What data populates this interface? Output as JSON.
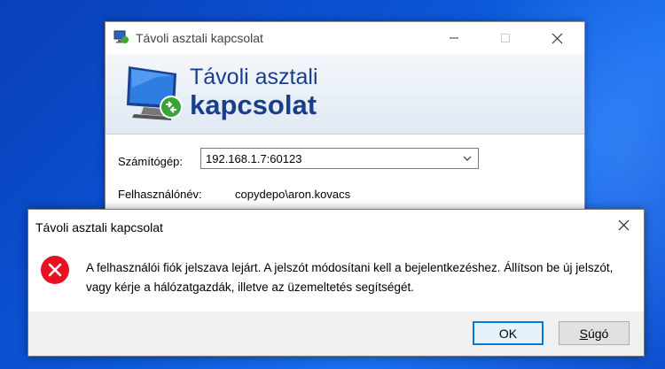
{
  "rdp_window": {
    "title": "Távoli asztali kapcsolat",
    "banner_line1": "Távoli asztali",
    "banner_line2": "kapcsolat",
    "computer_label": "Számítógép:",
    "computer_value": "192.168.1.7:60123",
    "username_label": "Felhasználónév:",
    "username_value": "copydepo\\aron.kovacs"
  },
  "error_dialog": {
    "title": "Távoli asztali kapcsolat",
    "message": "A felhasználói fiók jelszava lejárt. A jelszót módosítani kell a bejelentkezéshez. Állítson be új jelszót, vagy kérje a hálózatgazdák, illetve az üzemeltetés segítségét.",
    "ok_label": "OK",
    "help_label_first": "S",
    "help_label_rest": "úgó"
  },
  "colors": {
    "desktop": "#0b56d8",
    "banner_text": "#1a3e8a",
    "error_red": "#e81123",
    "focus_blue": "#0078d7"
  },
  "icons": [
    "rdp-app-icon",
    "rdp-monitor-icon",
    "minimize-icon",
    "maximize-icon",
    "close-icon",
    "chevron-down-icon",
    "error-icon"
  ]
}
